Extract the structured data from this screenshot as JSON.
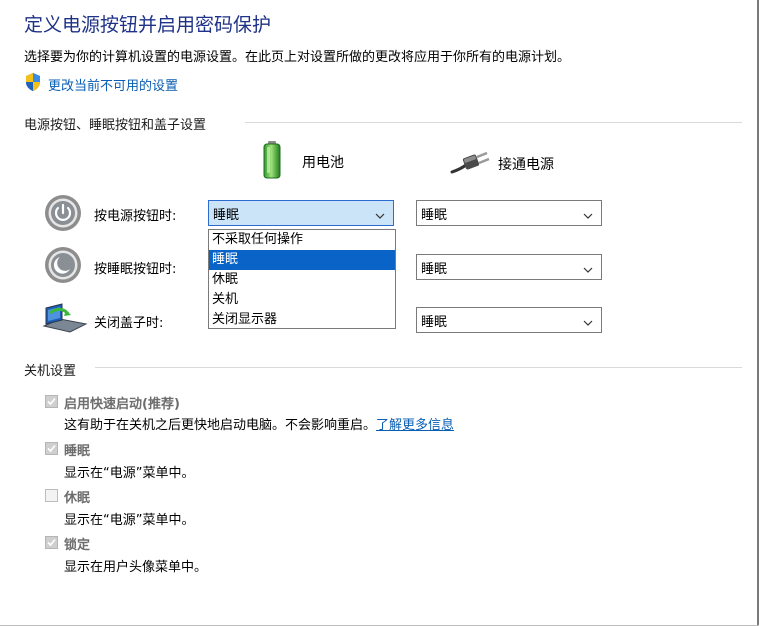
{
  "title": "定义电源按钮并启用密码保护",
  "description": "选择要为你的计算机设置的电源设置。在此页上对设置所做的更改将应用于你所有的电源计划。",
  "change_link": "更改当前不可用的设置",
  "buttons_section": {
    "heading": "电源按钮、睡眠按钮和盖子设置",
    "battery_label": "用电池",
    "plugged_label": "接通电源",
    "rows": [
      {
        "label": "按电源按钮时:",
        "battery": "睡眠",
        "plugged": "睡眠"
      },
      {
        "label": "按睡眠按钮时:",
        "battery": "睡眠",
        "plugged": "睡眠"
      },
      {
        "label": "关闭盖子时:",
        "battery": "睡眠",
        "plugged": "睡眠"
      }
    ],
    "dropdown_options": [
      "不采取任何操作",
      "睡眠",
      "休眠",
      "关机",
      "关闭显示器"
    ],
    "dropdown_selected": "睡眠"
  },
  "shutdown_section": {
    "heading": "关机设置",
    "items": [
      {
        "label": "启用快速启动(推荐)",
        "desc": "这有助于在关机之后更快地启动电脑。不会影响重启。",
        "link": "了解更多信息",
        "checked": true,
        "enabled": false
      },
      {
        "label": "睡眠",
        "desc": "显示在“电源”菜单中。",
        "checked": true,
        "enabled": false
      },
      {
        "label": "休眠",
        "desc": "显示在“电源”菜单中。",
        "checked": false,
        "enabled": false
      },
      {
        "label": "锁定",
        "desc": "显示在用户头像菜单中。",
        "checked": true,
        "enabled": false
      }
    ]
  },
  "colors": {
    "title": "#1e3287",
    "link": "#0a5db4",
    "selection": "#0a64c8",
    "active_select_bg": "#cce4f7"
  }
}
